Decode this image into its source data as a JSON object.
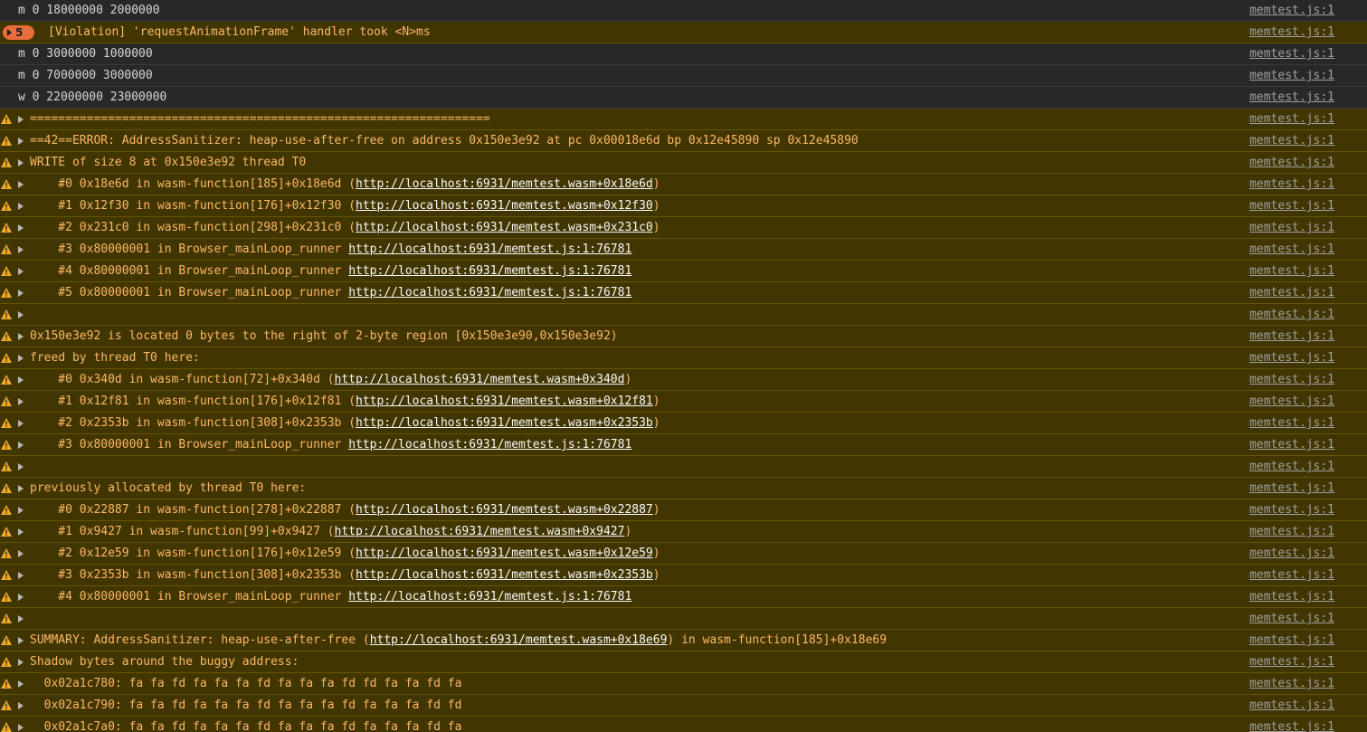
{
  "source_label": "memtest.js:1",
  "violation": {
    "count": "5",
    "text": "[Violation] 'requestAnimationFrame' handler took <N>ms"
  },
  "rows": [
    {
      "type": "log",
      "parts": [
        {
          "t": "m 0 18000000 2000000"
        }
      ]
    },
    {
      "type": "violation"
    },
    {
      "type": "log",
      "parts": [
        {
          "t": "m 0 3000000 1000000"
        }
      ]
    },
    {
      "type": "log",
      "parts": [
        {
          "t": "m 0 7000000 3000000"
        }
      ]
    },
    {
      "type": "log",
      "parts": [
        {
          "t": "w 0 22000000 23000000"
        }
      ]
    },
    {
      "type": "warn",
      "parts": [
        {
          "t": "================================================================="
        }
      ]
    },
    {
      "type": "warn",
      "parts": [
        {
          "t": "==42==ERROR: AddressSanitizer: heap-use-after-free on address 0x150e3e92 at pc 0x00018e6d bp 0x12e45890 sp 0x12e45890"
        }
      ]
    },
    {
      "type": "warn",
      "parts": [
        {
          "t": "WRITE of size 8 at 0x150e3e92 thread T0"
        }
      ]
    },
    {
      "type": "warn",
      "parts": [
        {
          "t": "    #0 0x18e6d in wasm-function[185]+0x18e6d ("
        },
        {
          "t": "http://localhost:6931/memtest.wasm+0x18e6d",
          "link": true
        },
        {
          "t": ")"
        }
      ]
    },
    {
      "type": "warn",
      "parts": [
        {
          "t": "    #1 0x12f30 in wasm-function[176]+0x12f30 ("
        },
        {
          "t": "http://localhost:6931/memtest.wasm+0x12f30",
          "link": true
        },
        {
          "t": ")"
        }
      ]
    },
    {
      "type": "warn",
      "parts": [
        {
          "t": "    #2 0x231c0 in wasm-function[298]+0x231c0 ("
        },
        {
          "t": "http://localhost:6931/memtest.wasm+0x231c0",
          "link": true
        },
        {
          "t": ")"
        }
      ]
    },
    {
      "type": "warn",
      "parts": [
        {
          "t": "    #3 0x80000001 in Browser_mainLoop_runner "
        },
        {
          "t": "http://localhost:6931/memtest.js:1:76781",
          "link": true
        }
      ]
    },
    {
      "type": "warn",
      "parts": [
        {
          "t": "    #4 0x80000001 in Browser_mainLoop_runner "
        },
        {
          "t": "http://localhost:6931/memtest.js:1:76781",
          "link": true
        }
      ]
    },
    {
      "type": "warn",
      "parts": [
        {
          "t": "    #5 0x80000001 in Browser_mainLoop_runner "
        },
        {
          "t": "http://localhost:6931/memtest.js:1:76781",
          "link": true
        }
      ]
    },
    {
      "type": "warn",
      "parts": [
        {
          "t": ""
        }
      ]
    },
    {
      "type": "warn",
      "parts": [
        {
          "t": "0x150e3e92 is located 0 bytes to the right of 2-byte region [0x150e3e90,0x150e3e92)"
        }
      ]
    },
    {
      "type": "warn",
      "parts": [
        {
          "t": "freed by thread T0 here:"
        }
      ]
    },
    {
      "type": "warn",
      "parts": [
        {
          "t": "    #0 0x340d in wasm-function[72]+0x340d ("
        },
        {
          "t": "http://localhost:6931/memtest.wasm+0x340d",
          "link": true
        },
        {
          "t": ")"
        }
      ]
    },
    {
      "type": "warn",
      "parts": [
        {
          "t": "    #1 0x12f81 in wasm-function[176]+0x12f81 ("
        },
        {
          "t": "http://localhost:6931/memtest.wasm+0x12f81",
          "link": true
        },
        {
          "t": ")"
        }
      ]
    },
    {
      "type": "warn",
      "parts": [
        {
          "t": "    #2 0x2353b in wasm-function[308]+0x2353b ("
        },
        {
          "t": "http://localhost:6931/memtest.wasm+0x2353b",
          "link": true
        },
        {
          "t": ")"
        }
      ]
    },
    {
      "type": "warn",
      "parts": [
        {
          "t": "    #3 0x80000001 in Browser_mainLoop_runner "
        },
        {
          "t": "http://localhost:6931/memtest.js:1:76781",
          "link": true
        }
      ]
    },
    {
      "type": "warn",
      "parts": [
        {
          "t": ""
        }
      ]
    },
    {
      "type": "warn",
      "parts": [
        {
          "t": "previously allocated by thread T0 here:"
        }
      ]
    },
    {
      "type": "warn",
      "parts": [
        {
          "t": "    #0 0x22887 in wasm-function[278]+0x22887 ("
        },
        {
          "t": "http://localhost:6931/memtest.wasm+0x22887",
          "link": true
        },
        {
          "t": ")"
        }
      ]
    },
    {
      "type": "warn",
      "parts": [
        {
          "t": "    #1 0x9427 in wasm-function[99]+0x9427 ("
        },
        {
          "t": "http://localhost:6931/memtest.wasm+0x9427",
          "link": true
        },
        {
          "t": ")"
        }
      ]
    },
    {
      "type": "warn",
      "parts": [
        {
          "t": "    #2 0x12e59 in wasm-function[176]+0x12e59 ("
        },
        {
          "t": "http://localhost:6931/memtest.wasm+0x12e59",
          "link": true
        },
        {
          "t": ")"
        }
      ]
    },
    {
      "type": "warn",
      "parts": [
        {
          "t": "    #3 0x2353b in wasm-function[308]+0x2353b ("
        },
        {
          "t": "http://localhost:6931/memtest.wasm+0x2353b",
          "link": true
        },
        {
          "t": ")"
        }
      ]
    },
    {
      "type": "warn",
      "parts": [
        {
          "t": "    #4 0x80000001 in Browser_mainLoop_runner "
        },
        {
          "t": "http://localhost:6931/memtest.js:1:76781",
          "link": true
        }
      ]
    },
    {
      "type": "warn",
      "parts": [
        {
          "t": ""
        }
      ]
    },
    {
      "type": "warn",
      "parts": [
        {
          "t": "SUMMARY: AddressSanitizer: heap-use-after-free ("
        },
        {
          "t": "http://localhost:6931/memtest.wasm+0x18e69",
          "link": true
        },
        {
          "t": ") in wasm-function[185]+0x18e69"
        }
      ]
    },
    {
      "type": "warn",
      "parts": [
        {
          "t": "Shadow bytes around the buggy address:"
        }
      ]
    },
    {
      "type": "warn",
      "parts": [
        {
          "t": "  0x02a1c780: fa fa fd fa fa fa fd fa fa fa fd fd fa fa fd fa"
        }
      ]
    },
    {
      "type": "warn",
      "parts": [
        {
          "t": "  0x02a1c790: fa fa fd fa fa fa fd fa fa fa fd fa fa fa fd fd"
        }
      ]
    },
    {
      "type": "warn",
      "parts": [
        {
          "t": "  0x02a1c7a0: fa fa fd fa fa fa fd fa fa fa fd fa fa fa fd fa"
        }
      ]
    }
  ]
}
